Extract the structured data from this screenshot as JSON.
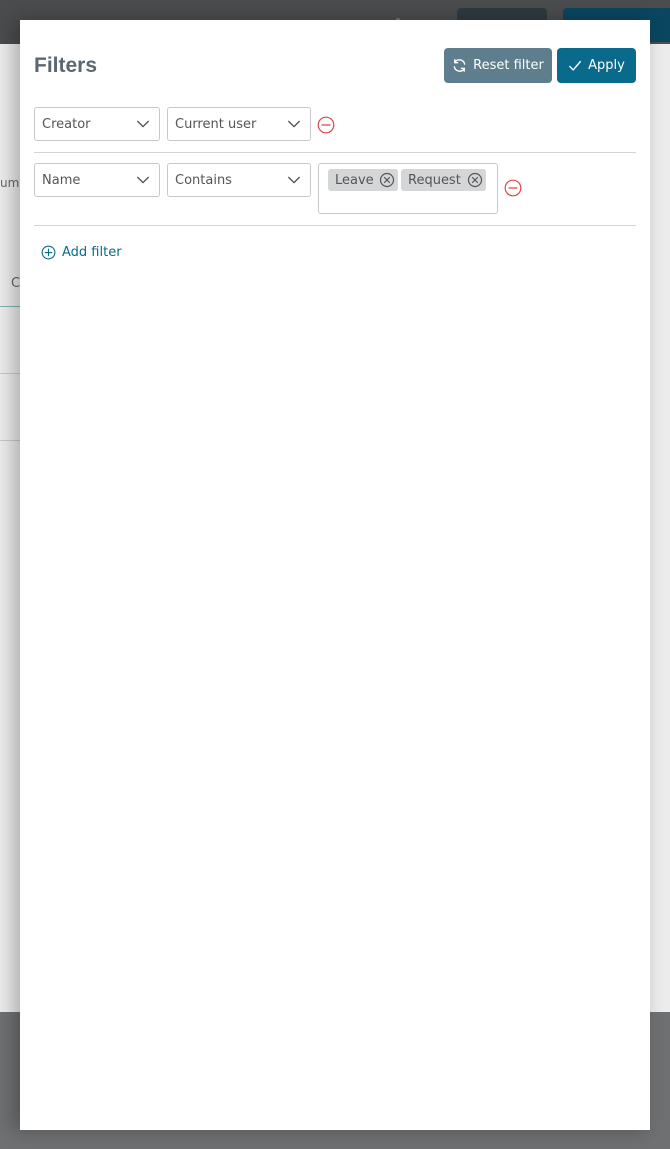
{
  "background": {
    "side_text": "umr",
    "side_c": "C"
  },
  "panel": {
    "title": "Filters",
    "reset_label": "Reset filter",
    "apply_label": "Apply",
    "filters": [
      {
        "field": "Creator",
        "operator": "Current user",
        "values": []
      },
      {
        "field": "Name",
        "operator": "Contains",
        "values": [
          "Leave",
          "Request"
        ]
      }
    ],
    "add_filter_label": "Add filter"
  },
  "colors": {
    "apply": "#0a6a8c",
    "reset": "#5e7e8d",
    "remove": "#e04545",
    "link": "#0a6a8c"
  },
  "icons": {
    "reset": "refresh-icon",
    "apply": "checkmark-icon",
    "remove": "minus-circle-icon",
    "add": "plus-circle-icon",
    "dropdown": "chevron-down-icon",
    "tag_remove": "close-circle-icon"
  }
}
